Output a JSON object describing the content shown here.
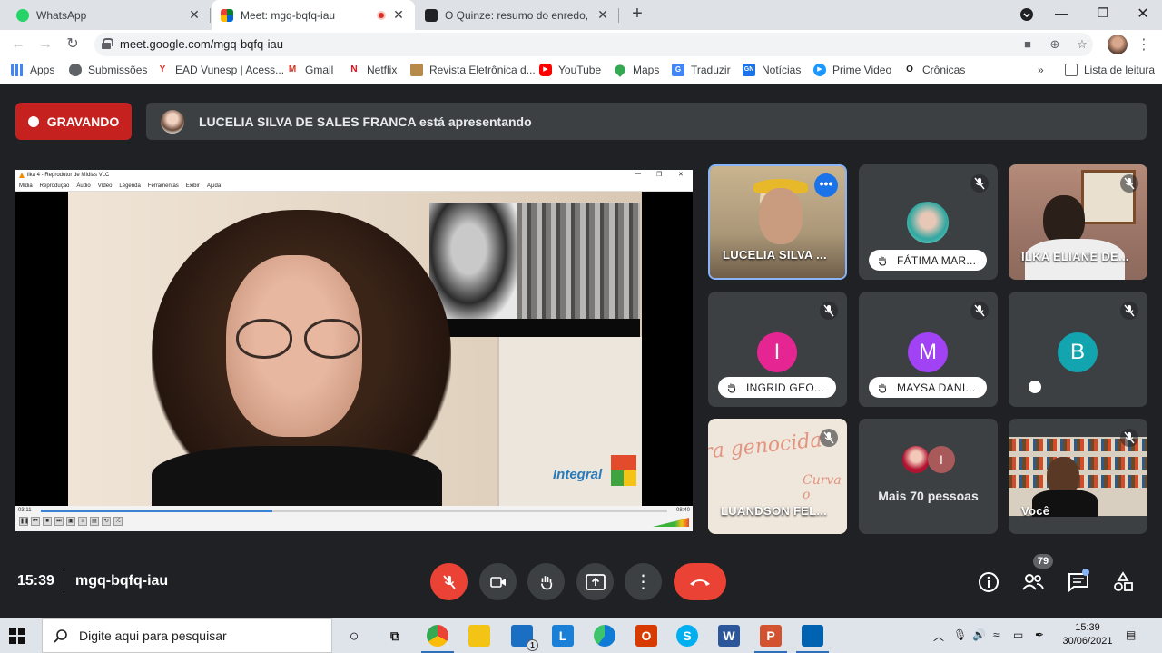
{
  "browser": {
    "tabs": [
      {
        "title": "WhatsApp",
        "active": false
      },
      {
        "title": "Meet: mgq-bqfq-iau",
        "active": true
      },
      {
        "title": "O Quinze: resumo do enredo, pe",
        "active": false
      }
    ],
    "url": "meet.google.com/mgq-bqfq-iau",
    "bookmarks": [
      {
        "label": "Apps",
        "icon": "apps-grid-icon"
      },
      {
        "label": "Submissões",
        "icon": "globe-icon"
      },
      {
        "label": "EAD Vunesp | Acess...",
        "icon": "vunesp-icon"
      },
      {
        "label": "Gmail",
        "icon": "gmail-icon"
      },
      {
        "label": "Netflix",
        "icon": "netflix-icon"
      },
      {
        "label": "Revista Eletrônica d...",
        "icon": "revista-icon"
      },
      {
        "label": "YouTube",
        "icon": "youtube-icon"
      },
      {
        "label": "Maps",
        "icon": "maps-icon"
      },
      {
        "label": "Traduzir",
        "icon": "translate-icon"
      },
      {
        "label": "Notícias",
        "icon": "news-icon"
      },
      {
        "label": "Prime Video",
        "icon": "prime-video-icon"
      },
      {
        "label": "Crônicas",
        "icon": "cronicas-icon"
      }
    ],
    "reading_list": "Lista de leitura"
  },
  "meet": {
    "recording_label": "GRAVANDO",
    "presenting_text": "LUCELIA SILVA DE SALES FRANCA está apresentando",
    "vlc": {
      "title": "ilka 4 - Reprodutor de Mídias VLC",
      "menu": [
        "Mídia",
        "Reprodução",
        "Áudio",
        "Vídeo",
        "Legenda",
        "Ferramentas",
        "Exibir",
        "Ajuda"
      ],
      "time_elapsed": "03:11",
      "time_total": "08:40",
      "progress": 0.37,
      "volume": "125%"
    },
    "participants": [
      {
        "name": "LUCELIA SILVA ...",
        "hand_raised": false,
        "muted": false
      },
      {
        "name": "FÁTIMA MAR...",
        "hand_raised": true,
        "muted": true
      },
      {
        "name": "ILKA ELIANE DE...",
        "hand_raised": false,
        "muted": true
      },
      {
        "name": "INGRID GEO...",
        "hand_raised": true,
        "muted": true,
        "initial": "I",
        "color": "#e52592"
      },
      {
        "name": "MAYSA DANI...",
        "hand_raised": true,
        "muted": true,
        "initial": "M",
        "color": "#a142f4"
      },
      {
        "name": "",
        "hand_raised": false,
        "muted": true,
        "initial": "B",
        "color": "#12a4af"
      },
      {
        "name": "LUANDSON FEL...",
        "hand_raised": false,
        "muted": true
      },
      {
        "name": "Mais 70 pessoas",
        "more_initial": "I"
      },
      {
        "name": "Você",
        "muted": true
      }
    ],
    "clock": "15:39",
    "meeting_code": "mgq-bqfq-iau",
    "people_count": "79"
  },
  "taskbar": {
    "search_placeholder": "Digite aqui para pesquisar",
    "time": "15:39",
    "date": "30/06/2021",
    "mail_badge": "1"
  }
}
